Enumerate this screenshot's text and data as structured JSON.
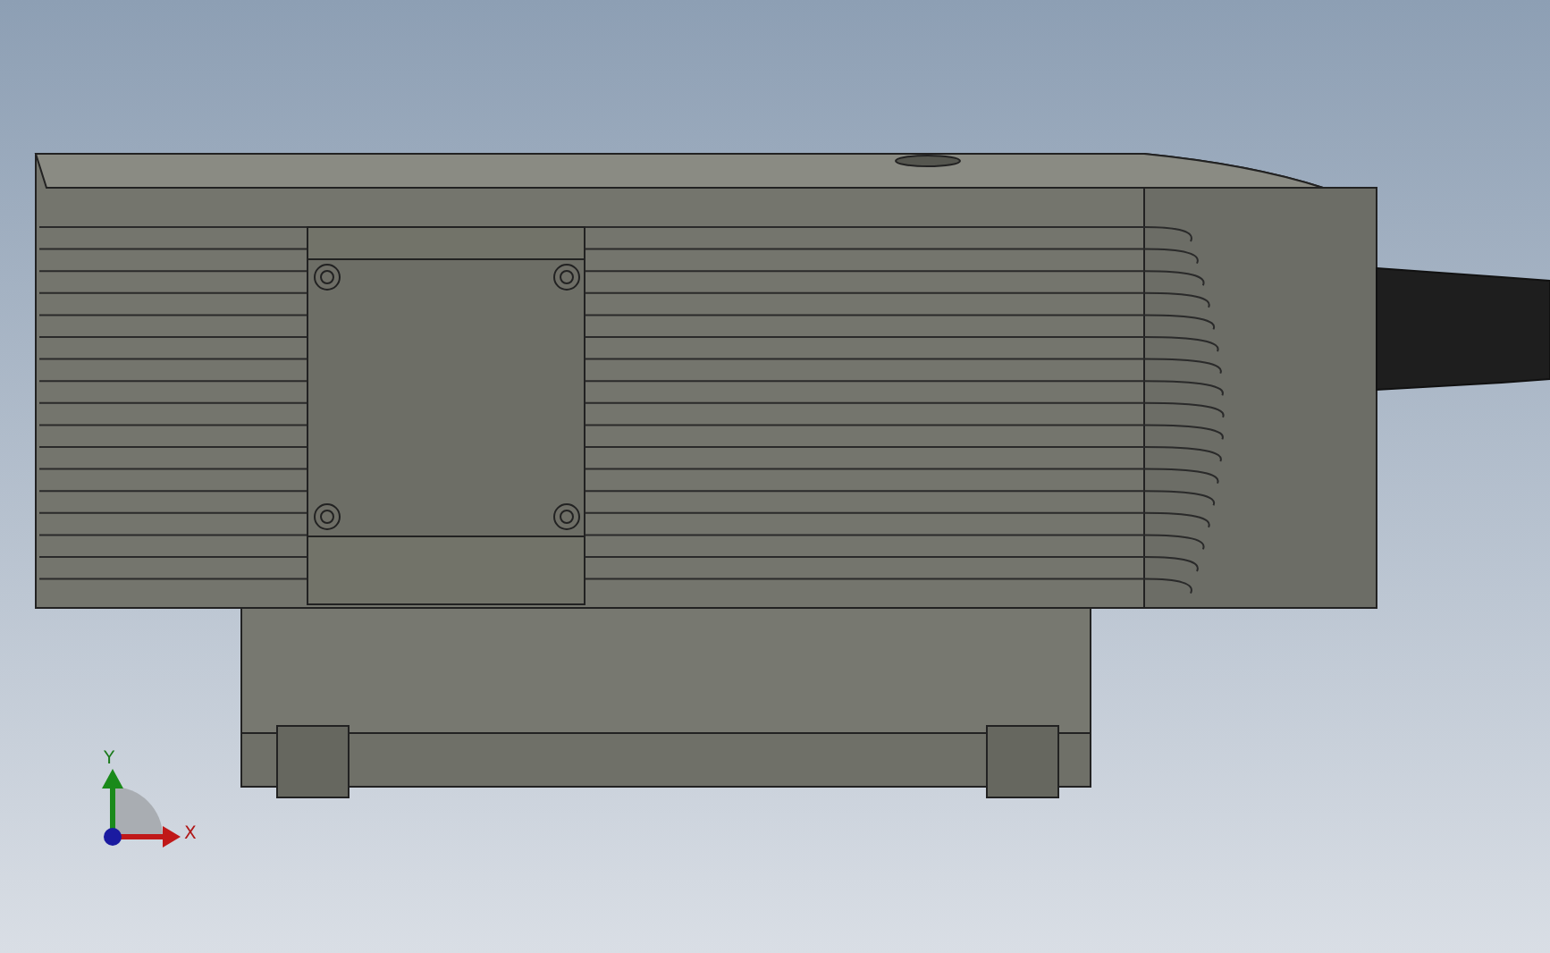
{
  "viewport": {
    "triad": {
      "y_label": "Y",
      "x_label": "X"
    }
  }
}
